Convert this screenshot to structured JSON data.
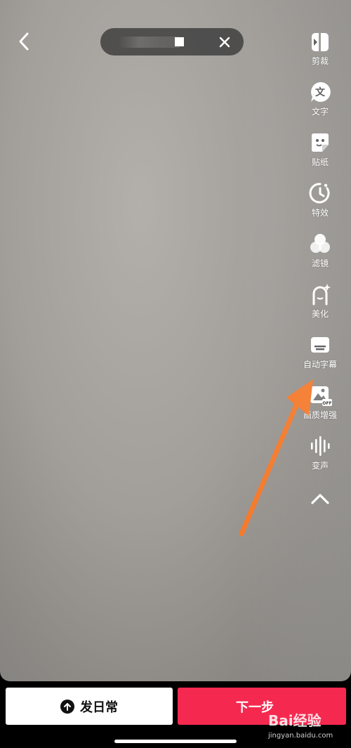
{
  "video": {
    "background_color": "#a29e9a"
  },
  "top_bar": {
    "back_icon": "chevron-left-icon",
    "recording_pill": {
      "stop_icon": "stop-square-icon",
      "close_icon": "close-icon"
    }
  },
  "toolbar": {
    "items": [
      {
        "label": "剪裁",
        "icon": "crop-clip-icon"
      },
      {
        "label": "文字",
        "icon": "text-bubble-icon"
      },
      {
        "label": "贴纸",
        "icon": "sticker-icon"
      },
      {
        "label": "特效",
        "icon": "effects-clock-icon"
      },
      {
        "label": "滤镜",
        "icon": "filter-circles-icon"
      },
      {
        "label": "美化",
        "icon": "beautify-face-icon"
      },
      {
        "label": "自动字幕",
        "icon": "auto-subtitle-icon"
      },
      {
        "label": "画质增强",
        "icon": "quality-enhance-icon"
      },
      {
        "label": "变声",
        "icon": "voice-wave-icon"
      }
    ],
    "collapse_icon": "chevron-up-icon"
  },
  "annotation": {
    "arrow_color": "#f47a2c"
  },
  "bottom": {
    "daily_button": {
      "label": "发日常",
      "icon": "upload-circle-icon"
    },
    "next_button": {
      "label": "下一步",
      "color": "#f5294f"
    }
  },
  "watermark": {
    "brand": "Bai经验",
    "site": "jingyan.baidu.com"
  }
}
